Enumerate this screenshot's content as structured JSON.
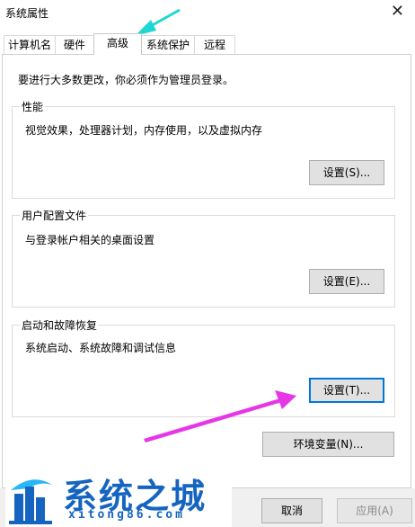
{
  "window": {
    "title": "系统属性",
    "close_glyph": "✕"
  },
  "tabs": [
    {
      "label": "计算机名"
    },
    {
      "label": "硬件"
    },
    {
      "label": "高级",
      "active": true
    },
    {
      "label": "系统保护"
    },
    {
      "label": "远程"
    }
  ],
  "advanced": {
    "notice": "要进行大多数更改，你必须作为管理员登录。",
    "performance": {
      "legend": "性能",
      "desc": "视觉效果，处理器计划，内存使用，以及虚拟内存",
      "button": "设置(S)..."
    },
    "user_profiles": {
      "legend": "用户配置文件",
      "desc": "与登录帐户相关的桌面设置",
      "button": "设置(E)..."
    },
    "startup_recovery": {
      "legend": "启动和故障恢复",
      "desc": "系统启动、系统故障和调试信息",
      "button": "设置(T)..."
    },
    "env_button": "环境变量(N)..."
  },
  "footer": {
    "cancel": "取消",
    "apply": "应用(A)"
  },
  "watermark": {
    "brand": "系统之城",
    "url": "xitong86.com"
  },
  "colors": {
    "arrow_cyan": "#1ed6d2",
    "arrow_magenta": "#e637e6",
    "focus_blue": "#0078d7",
    "brand_blue": "#1565c0"
  }
}
